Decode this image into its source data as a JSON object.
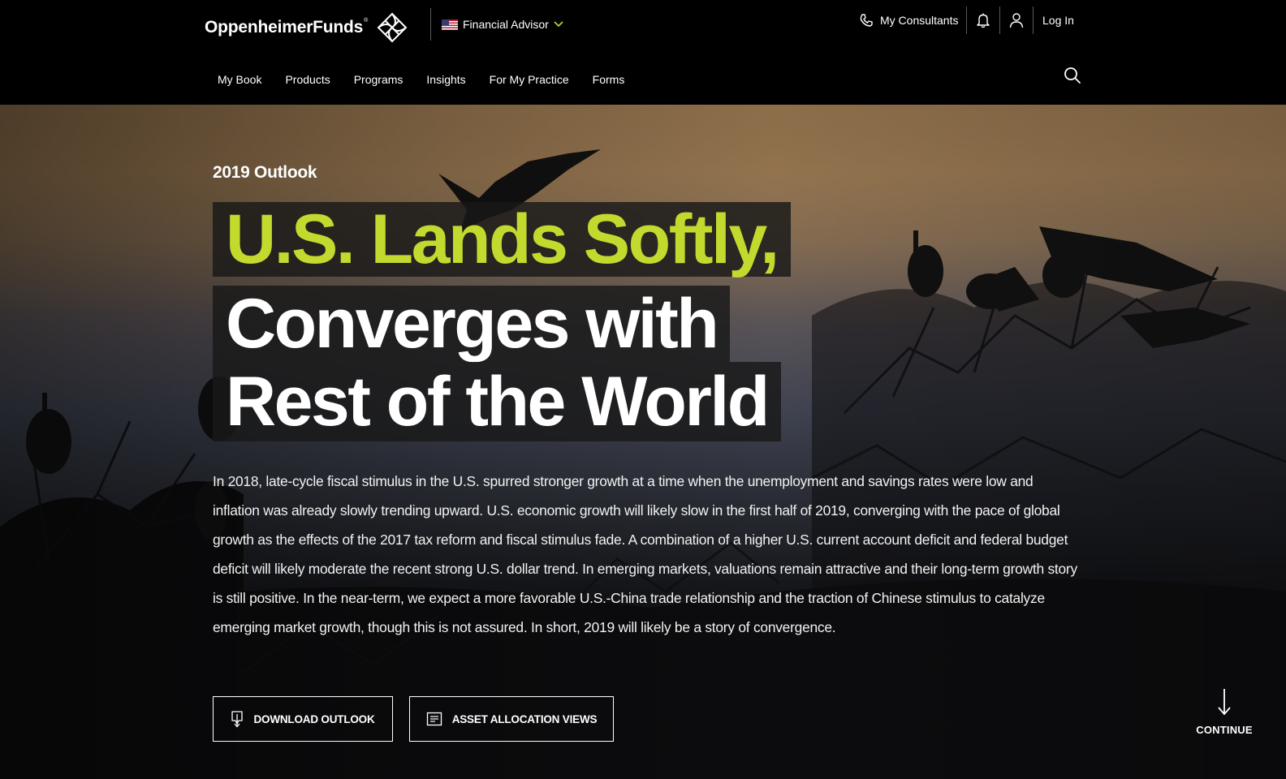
{
  "brand": {
    "name": "OppenheimerFunds",
    "registered_mark": "®"
  },
  "header": {
    "role_select": {
      "value": "Financial Advisor",
      "flag": "us-flag-icon"
    },
    "utility": {
      "consultants_label": "My Consultants",
      "login_label": "Log In"
    },
    "nav": [
      "My Book",
      "Products",
      "Programs",
      "Insights",
      "For My Practice",
      "Forms"
    ]
  },
  "hero": {
    "eyebrow": "2019 Outlook",
    "headline": {
      "line1": "U.S. Lands Softly,",
      "line2": "Converges with",
      "line3": "Rest of the World"
    },
    "body": "In 2018, late-cycle fiscal stimulus in the U.S. spurred stronger growth at a time when the unemployment and savings rates were low and inflation was already slowly trending upward. U.S. economic growth will likely slow in the first half of 2019, converging with the pace of global growth as the effects of the 2017 tax reform and fiscal stimulus fade. A combination of a higher U.S. current account deficit and federal budget deficit will likely moderate the recent strong U.S. dollar trend. In emerging markets, valuations remain attractive and their long-term growth story is still positive. In the near-term, we expect a more favorable U.S.-China trade relationship and the traction of Chinese stimulus to catalyze emerging market growth, though this is not assured. In short, 2019 will likely be a story of convergence.",
    "buttons": {
      "download": "DOWNLOAD OUTLOOK",
      "allocation": "ASSET ALLOCATION VIEWS"
    },
    "continue_label": "CONTINUE"
  },
  "colors": {
    "accent_lime": "#c4d92e",
    "header_bg": "#000000",
    "headline_band": "#181818"
  }
}
